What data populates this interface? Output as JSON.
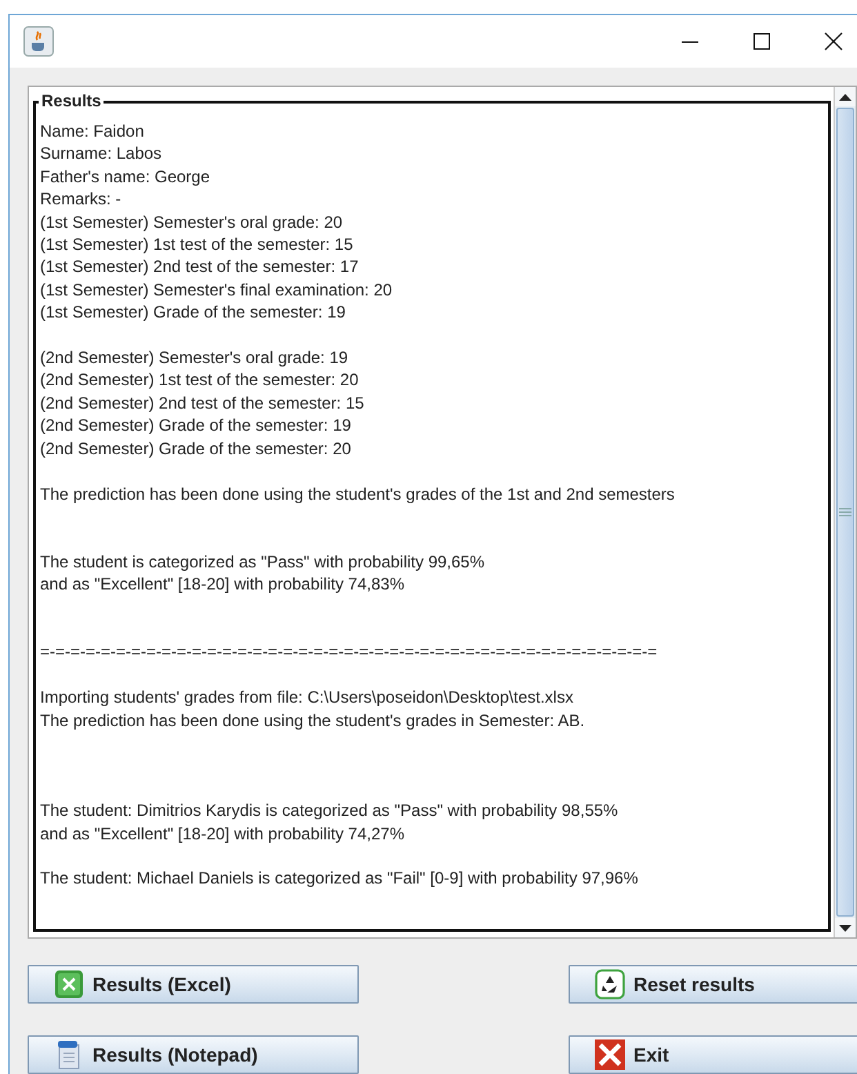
{
  "results": {
    "title": "Results",
    "text": "Name: Faidon\nSurname: Labos\nFather's name: George\nRemarks: -\n(1st Semester) Semester's oral grade: 20\n(1st Semester) 1st test of the semester: 15\n(1st Semester) 2nd test of the semester: 17\n(1st Semester) Semester's final examination: 20\n(1st Semester) Grade of the semester: 19\n\n(2nd Semester) Semester's oral grade: 19\n(2nd Semester) 1st test of the semester: 20\n(2nd Semester) 2nd test of the semester: 15\n(2nd Semester) Grade of the semester: 19\n(2nd Semester) Grade of the semester: 20\n\nThe prediction has been done using the student's grades of the 1st and 2nd semesters\n\n\nThe student is categorized as \"Pass\" with probability 99,65%\nand as \"Excellent\" [18-20] with probability 74,83%\n\n\n=-=-=-=-=-=-=-=-=-=-=-=-=-=-=-=-=-=-=-=-=-=-=-=-=-=-=-=-=-=-=-=-=-=-=-=-=-=-=-=-=\n\nImporting students' grades from file: C:\\Users\\poseidon\\Desktop\\test.xlsx\nThe prediction has been done using the student's grades in Semester: AB.\n\n\n\nThe student: Dimitrios Karydis is categorized as \"Pass\" with probability 98,55%\nand as \"Excellent\" [18-20] with probability 74,27%\n\nThe student: Michael Daniels is categorized as \"Fail\" [0-9] with probability 97,96%"
  },
  "buttons": [
    {
      "label": "Results (Excel)"
    },
    {
      "label": "Reset results"
    },
    {
      "label": "Results (Notepad)"
    },
    {
      "label": "Exit"
    }
  ]
}
